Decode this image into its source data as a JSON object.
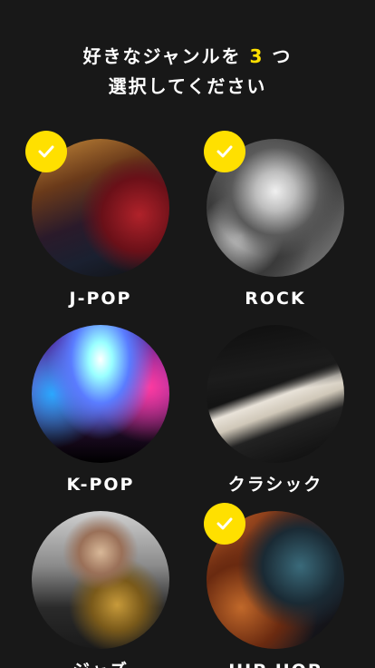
{
  "header": {
    "line1_prefix": "好きなジャンルを",
    "count": "3",
    "line1_suffix": "つ",
    "line2": "選択してください"
  },
  "colors": {
    "background": "#181818",
    "accent": "#FFE000",
    "text": "#FFFFFF"
  },
  "genres": [
    {
      "label": "J-POP",
      "selected": true
    },
    {
      "label": "ROCK",
      "selected": true
    },
    {
      "label": "K-POP",
      "selected": false
    },
    {
      "label": "クラシック",
      "selected": false
    },
    {
      "label": "ジャズ",
      "selected": false
    },
    {
      "label": "HIP HOP",
      "selected": true
    }
  ],
  "icons": {
    "check": "check-icon"
  }
}
